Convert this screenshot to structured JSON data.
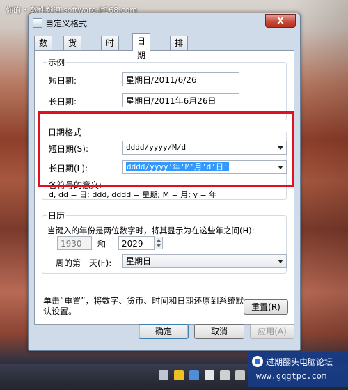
{
  "watermark_top": "你的 • 软件频道 software.it168.com",
  "window": {
    "title": "自定义格式",
    "close_label": "X"
  },
  "tabs": [
    {
      "label": "数字"
    },
    {
      "label": "货币"
    },
    {
      "label": "时间"
    },
    {
      "label": "日期"
    },
    {
      "label": "排序"
    }
  ],
  "examples": {
    "title": "示例",
    "short_label": "短日期:",
    "short_value": "星期日/2011/6/26",
    "long_label": "长日期:",
    "long_value": "星期日/2011年6月26日"
  },
  "date_format": {
    "title": "日期格式",
    "short_label": "短日期(S):",
    "short_value": "dddd/yyyy/M/d",
    "long_label": "长日期(L):",
    "long_value": "dddd/yyyy'年'M'月'd'日'",
    "legend_title": "各符号的意义:",
    "legend_text": "d, dd = 日; ddd, dddd = 星期; M = 月; y = 年"
  },
  "calendar": {
    "title": "日历",
    "two_digit_label": "当键入的年份是两位数字时，将其显示为在这些年之间(H):",
    "year_from": "1930",
    "and_label": "和",
    "year_to": "2029",
    "first_day_label": "一周的第一天(F):",
    "first_day_value": "星期日"
  },
  "reset": {
    "text": "单击“重置”，将数字、货币、时间和日期还原到系统默认设置。",
    "button": "重置(R)"
  },
  "footer": {
    "ok": "确定",
    "cancel": "取消",
    "apply": "应用(A)"
  },
  "watermark_bottom": {
    "line1": "过期翻头电脑论坛",
    "line2": "www.gqgtpc.com"
  }
}
